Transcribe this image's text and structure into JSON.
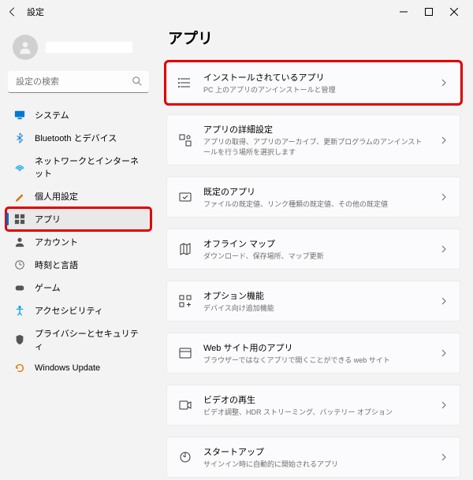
{
  "window": {
    "title": "設定"
  },
  "search": {
    "placeholder": "設定の検索"
  },
  "nav": {
    "items": [
      {
        "label": "システム"
      },
      {
        "label": "Bluetooth とデバイス"
      },
      {
        "label": "ネットワークとインターネット"
      },
      {
        "label": "個人用設定"
      },
      {
        "label": "アプリ"
      },
      {
        "label": "アカウント"
      },
      {
        "label": "時刻と言語"
      },
      {
        "label": "ゲーム"
      },
      {
        "label": "アクセシビリティ"
      },
      {
        "label": "プライバシーとセキュリティ"
      },
      {
        "label": "Windows Update"
      }
    ]
  },
  "page": {
    "title": "アプリ",
    "cards": [
      {
        "title": "インストールされているアプリ",
        "sub": "PC 上のアプリのアンインストールと管理"
      },
      {
        "title": "アプリの詳細設定",
        "sub": "アプリの取得、アプリのアーカイブ、更新プログラムのアンインストールを行う場所を選択します"
      },
      {
        "title": "既定のアプリ",
        "sub": "ファイルの既定値、リンク種類の既定値、その他の既定値"
      },
      {
        "title": "オフライン マップ",
        "sub": "ダウンロード、保存場所、マップ更新"
      },
      {
        "title": "オプション機能",
        "sub": "デバイス向け追加機能"
      },
      {
        "title": "Web サイト用のアプリ",
        "sub": "ブラウザーではなくアプリで開くことができる web サイト"
      },
      {
        "title": "ビデオの再生",
        "sub": "ビデオ調整、HDR ストリーミング、バッテリー オプション"
      },
      {
        "title": "スタートアップ",
        "sub": "サインイン時に自動的に開始されるアプリ"
      }
    ]
  }
}
